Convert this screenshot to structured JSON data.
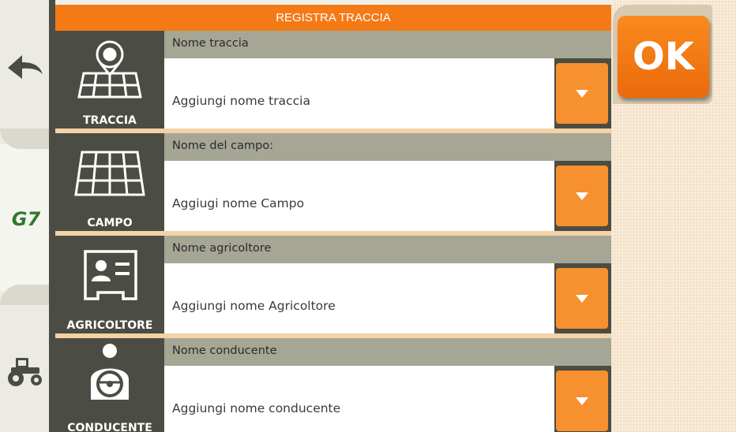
{
  "header": {
    "title": "REGISTRA TRACCIA"
  },
  "ok_button": {
    "label": "OK"
  },
  "sidebar": {
    "brand_logo": "G7",
    "back_icon": "back-arrow-icon",
    "tractor_icon": "tractor-icon"
  },
  "rows": [
    {
      "icon": "track-icon",
      "icon_label": "TRACCIA",
      "title": "Nome traccia",
      "value": "Aggiungi nome traccia",
      "dropdown_icon": "chevron-down-icon"
    },
    {
      "icon": "field-icon",
      "icon_label": "CAMPO",
      "title": "Nome del campo:",
      "value": "Aggiugi nome Campo",
      "dropdown_icon": "chevron-down-icon"
    },
    {
      "icon": "farmer-card-icon",
      "icon_label": "AGRICOLTORE",
      "title": "Nome agricoltore",
      "value": "Aggiungi nome Agricoltore",
      "dropdown_icon": "chevron-down-icon"
    },
    {
      "icon": "driver-icon",
      "icon_label": "CONDUCENTE",
      "title": "Nome conducente",
      "value": "Aggiungi nome conducente",
      "dropdown_icon": "chevron-down-icon"
    }
  ],
  "colors": {
    "accent": "#f47a16",
    "panel": "#4b4c43",
    "title_bar": "#a6a695"
  }
}
